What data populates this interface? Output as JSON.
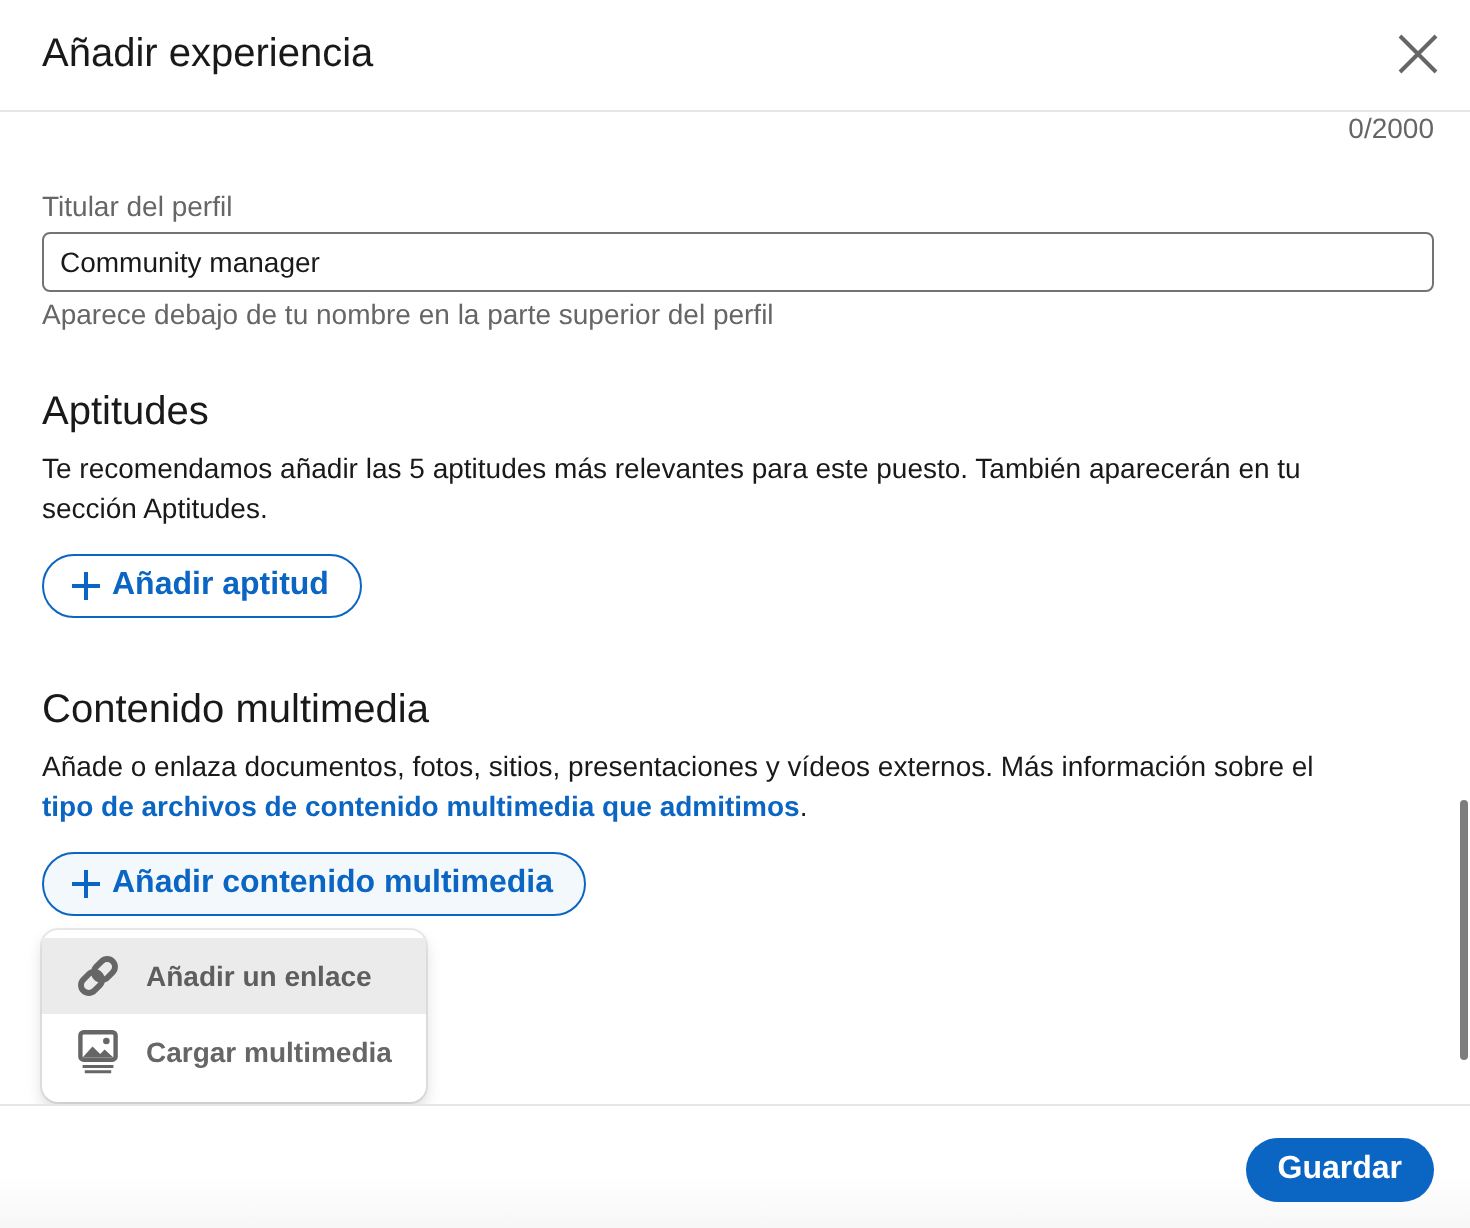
{
  "dialog": {
    "title": "Añadir experiencia"
  },
  "description_counter": "0/2000",
  "headline_field": {
    "label": "Titular del perfil",
    "value": "Community manager",
    "hint": "Aparece debajo de tu nombre en la parte superior del perfil"
  },
  "skills": {
    "title": "Aptitudes",
    "text": "Te recomendamos añadir las 5 aptitudes más relevantes para este puesto. También aparecerán en tu sección Aptitudes.",
    "add_button": {
      "label": "Añadir aptitud"
    }
  },
  "media": {
    "title": "Contenido multimedia",
    "text": "Añade o enlaza documentos, fotos, sitios, presentaciones y vídeos externos. Más información sobre el ",
    "link": "tipo de archivos de contenido multimedia que admitimos",
    "text_end": ".",
    "add_button": {
      "label": "Añadir contenido multimedia",
      "expanded": true
    },
    "menu": {
      "items": [
        {
          "kind": "link",
          "label": "Añadir un enlace",
          "selected": true
        },
        {
          "kind": "upload",
          "label": "Cargar multimedia",
          "selected": false
        }
      ]
    }
  },
  "footer": {
    "save_button": "Guardar"
  }
}
